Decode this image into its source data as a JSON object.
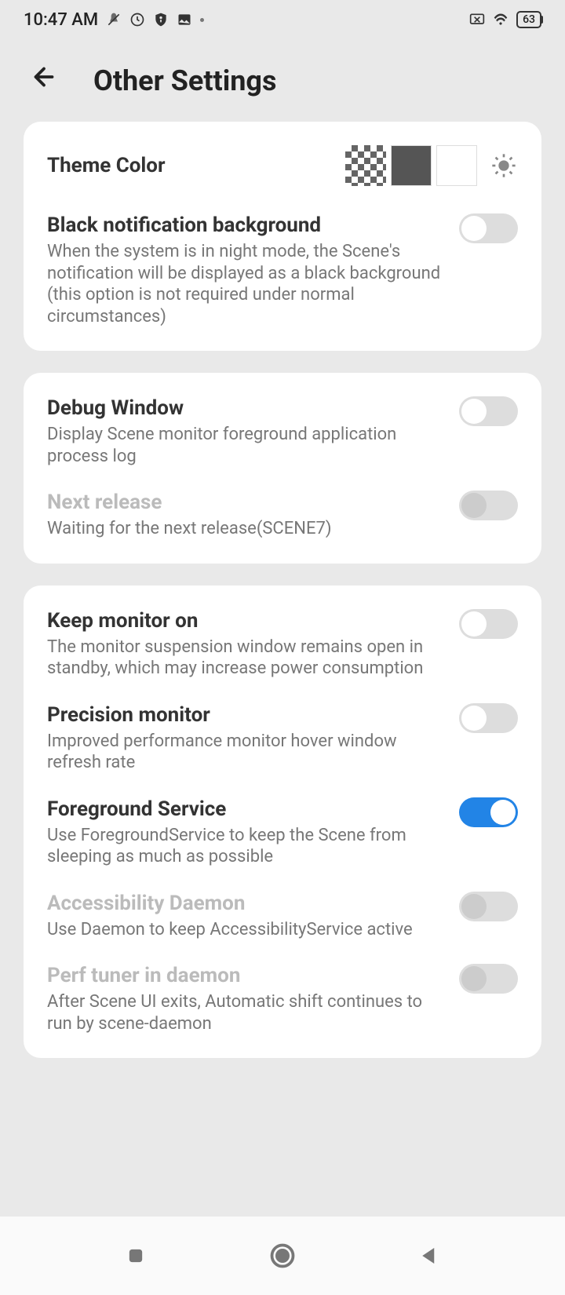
{
  "statusBar": {
    "time": "10:47 AM",
    "battery": "63"
  },
  "header": {
    "title": "Other Settings"
  },
  "theme": {
    "label": "Theme Color"
  },
  "settings": {
    "blackNotif": {
      "title": "Black notification background",
      "desc": "When the system is in night mode, the Scene's notification will be displayed as a black background (this option is not required under normal circumstances)"
    },
    "debugWindow": {
      "title": "Debug Window",
      "desc": "Display Scene monitor foreground application process log"
    },
    "nextRelease": {
      "title": "Next release",
      "desc": "Waiting for the next release(SCENE7)"
    },
    "keepMonitor": {
      "title": "Keep monitor on",
      "desc": "The monitor suspension window remains open in standby, which may increase power consumption"
    },
    "precisionMonitor": {
      "title": "Precision monitor",
      "desc": "Improved performance monitor hover window refresh rate"
    },
    "foregroundService": {
      "title": "Foreground Service",
      "desc": "Use ForegroundService to keep the Scene from sleeping as much as possible"
    },
    "accessibilityDaemon": {
      "title": "Accessibility Daemon",
      "desc": "Use Daemon to keep AccessibilityService active"
    },
    "perfTuner": {
      "title": "Perf tuner in daemon",
      "desc": "After Scene UI exits, Automatic shift continues to run by scene-daemon"
    }
  }
}
